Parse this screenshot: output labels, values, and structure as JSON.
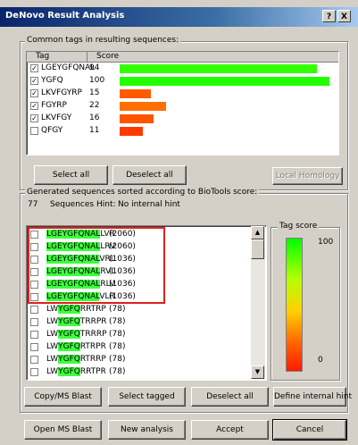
{
  "window": {
    "title": "DeNovo Result Analysis",
    "help_glyph": "?",
    "close_glyph": "X"
  },
  "tags_group": {
    "label": "Common tags in resulting sequences:",
    "col_tag": "Tag",
    "col_score": "Score",
    "rows": [
      {
        "tag": "LGEYGFQNAL",
        "score": "94",
        "checked": true,
        "bar_fraction": 0.94,
        "bar_color": "#33ff00"
      },
      {
        "tag": "YGFQ",
        "score": "100",
        "checked": true,
        "bar_fraction": 1.0,
        "bar_color": "#22ff00"
      },
      {
        "tag": "LKVFGYRP",
        "score": "15",
        "checked": true,
        "bar_fraction": 0.15,
        "bar_color": "#ff5a00"
      },
      {
        "tag": "FGYRP",
        "score": "22",
        "checked": true,
        "bar_fraction": 0.22,
        "bar_color": "#ff7000"
      },
      {
        "tag": "LKVFGY",
        "score": "16",
        "checked": true,
        "bar_fraction": 0.16,
        "bar_color": "#ff5500"
      },
      {
        "tag": "QFGY",
        "score": "11",
        "checked": false,
        "bar_fraction": 0.11,
        "bar_color": "#ff3a00"
      }
    ],
    "select_all": "Select all",
    "deselect_all": "Deselect all",
    "local_homology": "Local Homology"
  },
  "seq_group": {
    "label": "Generated sequences sorted according to BioTools score:",
    "count": "77",
    "count_label": "Sequences",
    "hint_label": "Hint:",
    "hint_value": "No internal hint",
    "rows": [
      {
        "pre": "",
        "hl": "LGEYGFQNAL",
        "post": "LVR",
        "score": "(2060)",
        "checked": false
      },
      {
        "pre": "",
        "hl": "LGEYGFQNAL",
        "post": "LRV",
        "score": "(2060)",
        "checked": false
      },
      {
        "pre": "",
        "hl": "LGEYGFQNAL",
        "post": "VRL",
        "score": "(1036)",
        "checked": false
      },
      {
        "pre": "",
        "hl": "LGEYGFQNAL",
        "post": "RVL",
        "score": "(1036)",
        "checked": false
      },
      {
        "pre": "",
        "hl": "LGEYGFQNAL",
        "post": "RLV",
        "score": "(1036)",
        "checked": false
      },
      {
        "pre": "",
        "hl": "LGEYGFQNAL",
        "post": "VLR",
        "score": "(1036)",
        "checked": false
      },
      {
        "pre": "LW",
        "hl": "YGFQ",
        "post": "RRTRP",
        "score": "(78)",
        "checked": false
      },
      {
        "pre": "LW",
        "hl": "YGFQ",
        "post": "TRRPR",
        "score": "(78)",
        "checked": false
      },
      {
        "pre": "LW",
        "hl": "YGFQ",
        "post": "TRRRP",
        "score": "(78)",
        "checked": false
      },
      {
        "pre": "LW",
        "hl": "YGFQ",
        "post": "RTRPR",
        "score": "(78)",
        "checked": false
      },
      {
        "pre": "LW",
        "hl": "YGFQ",
        "post": "RTRRP",
        "score": "(78)",
        "checked": false
      },
      {
        "pre": "LW",
        "hl": "YGFQ",
        "post": "RRTPR",
        "score": "(78)",
        "checked": false
      }
    ],
    "tag_score_label": "Tag score",
    "legend_max": "100",
    "legend_min": "0",
    "copy_blast": "Copy/MS Blast",
    "select_tagged": "Select tagged",
    "deselect_all": "Deselect all",
    "define_hint": "Define internal hint"
  },
  "footer": {
    "open_blast": "Open MS Blast",
    "new_analysis": "New analysis",
    "accept": "Accept",
    "cancel": "Cancel"
  },
  "colors": {
    "highlight_green": "#3cff3c",
    "annotation_red": "#e0201c",
    "title_blue": "#0a246a"
  }
}
